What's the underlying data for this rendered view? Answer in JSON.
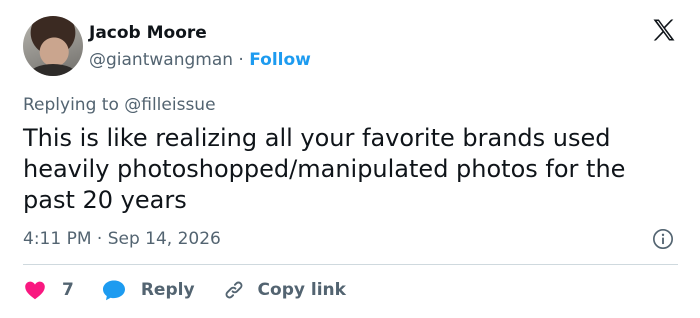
{
  "author": {
    "name": "Jacob Moore",
    "handle": "@giantwangman",
    "separator": "·",
    "follow_label": "Follow"
  },
  "reply_context": "Replying to @filleissue",
  "tweet": {
    "text": "This is like realizing all your favorite brands used heavily photoshopped/manipulated photos for the past 20 years"
  },
  "meta": {
    "time": "4:11 PM",
    "separator": "·",
    "date": "Sep 14, 2026"
  },
  "actions": {
    "like_count": "7",
    "reply_label": "Reply",
    "copy_label": "Copy link"
  },
  "icons": {
    "logo": "x-logo-icon",
    "info": "info-icon",
    "like": "heart-icon",
    "reply": "speech-bubble-icon",
    "copy": "link-icon"
  },
  "colors": {
    "accent": "#1d9bf0",
    "like": "#f91880",
    "text": "#0f1419",
    "secondary": "#536471",
    "divider": "#cfd9de"
  }
}
